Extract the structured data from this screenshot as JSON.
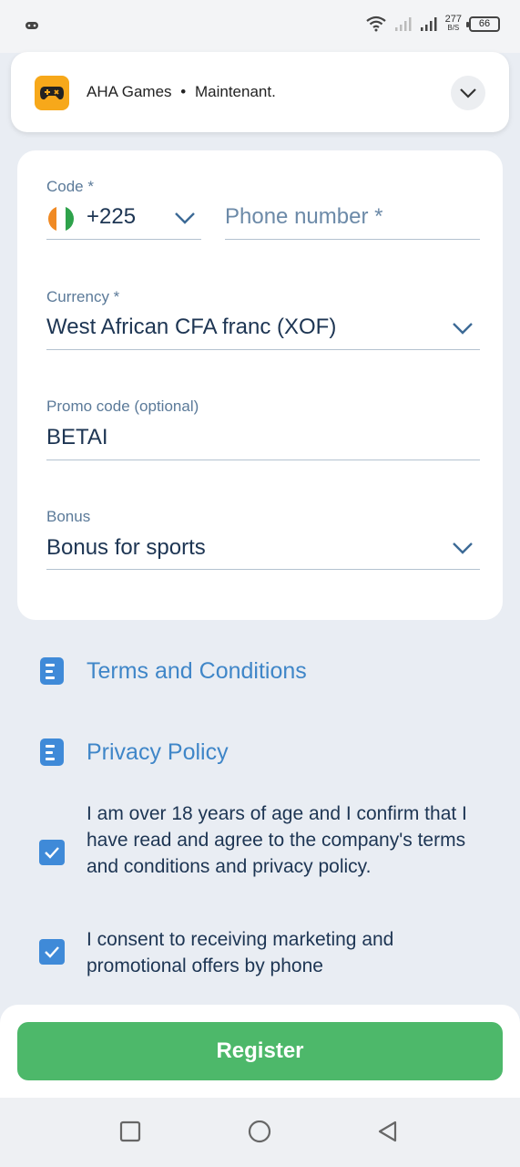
{
  "status_bar": {
    "net_speed_value": "277",
    "net_speed_unit": "B/S",
    "battery": "66"
  },
  "notification": {
    "app_name": "AHA Games",
    "separator": "•",
    "time": "Maintenant."
  },
  "form": {
    "code": {
      "label": "Code *",
      "value": "+225"
    },
    "phone": {
      "placeholder": "Phone number *"
    },
    "currency": {
      "label": "Currency *",
      "value": "West African CFA franc (XOF)"
    },
    "promo": {
      "label": "Promo code (optional)",
      "value": "BETAI"
    },
    "bonus": {
      "label": "Bonus",
      "value": "Bonus for sports"
    }
  },
  "links": {
    "terms": "Terms and Conditions",
    "privacy": "Privacy Policy"
  },
  "consents": {
    "age": {
      "text": "I am over 18 years of age and I confirm that I have read and agree to the company's terms and conditions and privacy policy.",
      "checked": true
    },
    "marketing": {
      "text": "I consent to receiving marketing and promotional offers by phone",
      "checked": true
    }
  },
  "actions": {
    "register": "Register"
  },
  "colors": {
    "accent": "#3f8ad8",
    "register": "#4db86a",
    "link": "#3f86c8",
    "text": "#1d3553"
  }
}
